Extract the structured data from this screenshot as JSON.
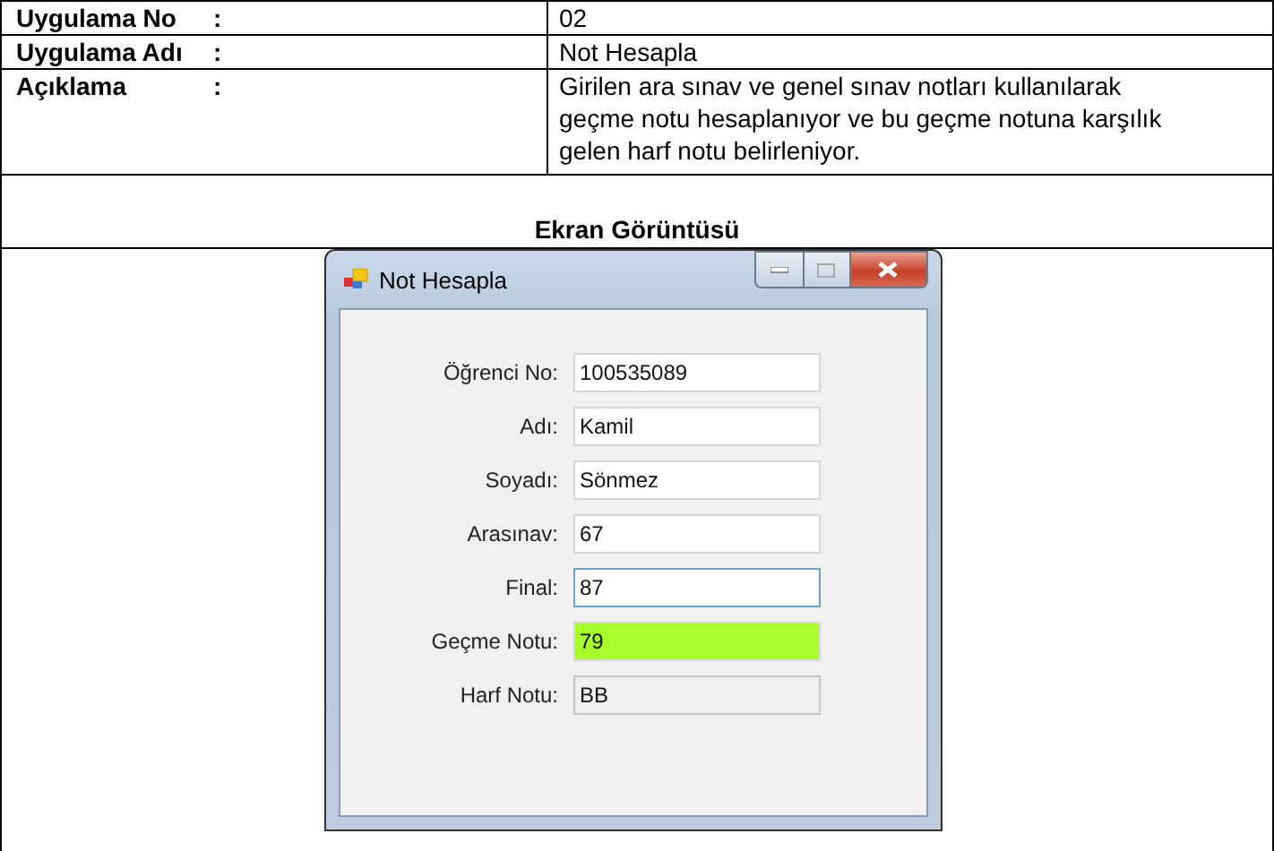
{
  "info_table": {
    "rows": [
      {
        "label": "Uygulama No",
        "colon": ":",
        "value": "02"
      },
      {
        "label": "Uygulama Adı",
        "colon": ":",
        "value": "Not Hesapla"
      },
      {
        "label": "Açıklama",
        "colon": ":",
        "value": "Girilen ara sınav ve genel sınav notları kullanılarak geçme notu hesaplanıyor ve bu geçme notuna karşılık gelen harf notu belirleniyor."
      }
    ],
    "section_heading": "Ekran Görüntüsü"
  },
  "window": {
    "title": "Not Hesapla",
    "fields": [
      {
        "label": "Öğrenci No:",
        "value": "100535089",
        "kind": "text"
      },
      {
        "label": "Adı:",
        "value": "Kamil",
        "kind": "text"
      },
      {
        "label": "Soyadı:",
        "value": "Sönmez",
        "kind": "text"
      },
      {
        "label": "Arasınav:",
        "value": "67",
        "kind": "text"
      },
      {
        "label": "Final:",
        "value": "87",
        "kind": "focused"
      },
      {
        "label": "Geçme Notu:",
        "value": "79",
        "kind": "highlighted"
      },
      {
        "label": "Harf Notu:",
        "value": "BB",
        "kind": "readonly"
      }
    ]
  }
}
